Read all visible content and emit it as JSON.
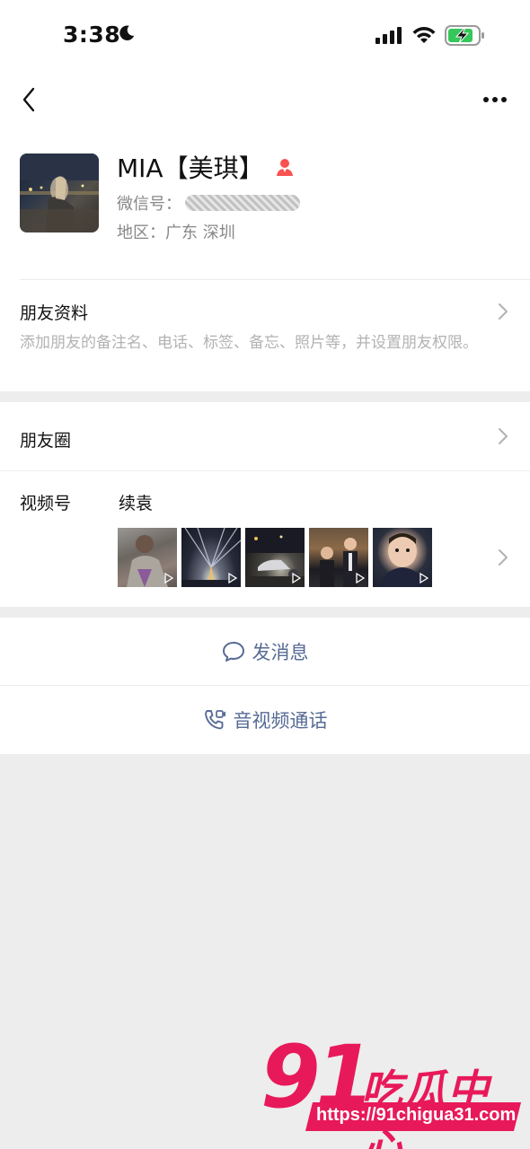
{
  "status_bar": {
    "time": "3:38",
    "icons": [
      "moon-icon",
      "signal-icon",
      "wifi-icon",
      "battery-charging-icon"
    ]
  },
  "nav": {
    "back_icon": "chevron-left-icon",
    "more_icon": "ellipsis-icon"
  },
  "profile": {
    "display_name": "MIA【美琪】",
    "gender_icon": "female-user-icon",
    "wechat_id_label": "微信号：",
    "region_label": "地区：",
    "region_value": "广东 深圳"
  },
  "friend_info": {
    "title": "朋友资料",
    "description": "添加朋友的备注名、电话、标签、备忘、照片等，并设置朋友权限。"
  },
  "moments": {
    "title": "朋友圈"
  },
  "channels": {
    "title": "视频号",
    "channel_name": "续袁",
    "thumbnail_count": 5
  },
  "actions": {
    "send_message": "发消息",
    "av_call": "音视频通话"
  },
  "watermark": {
    "brand_number": "91",
    "brand_text": "吃瓜中心",
    "url": "https://91chigua31.com"
  },
  "colors": {
    "link_blue": "#576b95",
    "background": "#ededed",
    "watermark_pink": "#e8195a"
  }
}
